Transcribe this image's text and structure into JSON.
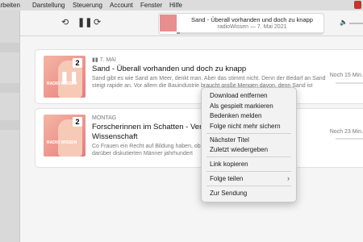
{
  "menubar": {
    "items": [
      "arbeiten",
      "Darstellung",
      "Steuerung",
      "Account",
      "Fenster",
      "Hilfe"
    ]
  },
  "toolbar": {
    "back_icon": "rewind-15-icon",
    "play_pause_icon": "pause-icon",
    "forward_icon": "forward-30-icon",
    "now_playing": {
      "title": "Sand - Überall vorhanden und doch zu knapp",
      "subtitle": "radioWissen — 7. Mai 2021",
      "progress": 0.02
    },
    "volume": 0.85
  },
  "episodes": [
    {
      "date": "7. MAI",
      "title": "Sand - Überall vorhanden und doch zu knapp",
      "description": "Sand gibt es wie Sand am Meer, denkt man. Aber das stimmt nicht. Denn der Bedarf an Sand steigt rapide an. Vor allem die Bauindustrie braucht große Mengen davon, denn Sand ist",
      "duration": "Noch 15 Min.",
      "artwork_label": "RADIO WISSEN",
      "badge": "2",
      "progress": 0.03,
      "state": "playing"
    },
    {
      "date": "MONTAG",
      "title": "Forscherinnen im Schatten - Vergess",
      "title_line2": "Wissenschaft",
      "description": "Co Frauen ein Recht auf Bildung haben, ob c sind, darüber diskutierten Männer jahrhundert",
      "duration": "Noch 23 Min.",
      "artwork_label": "RADIO WISSEN",
      "badge": "2",
      "progress": 0.0,
      "state": "unplayed"
    }
  ],
  "context_menu": {
    "items": [
      "Download entfernen",
      "Als gespielt markieren",
      "Bedenken melden",
      "Folge nicht mehr sichern",
      "Nächster Titel",
      "Zuletzt wiedergeben",
      "Link kopieren",
      "Folge teilen",
      "Zur Sendung"
    ]
  }
}
